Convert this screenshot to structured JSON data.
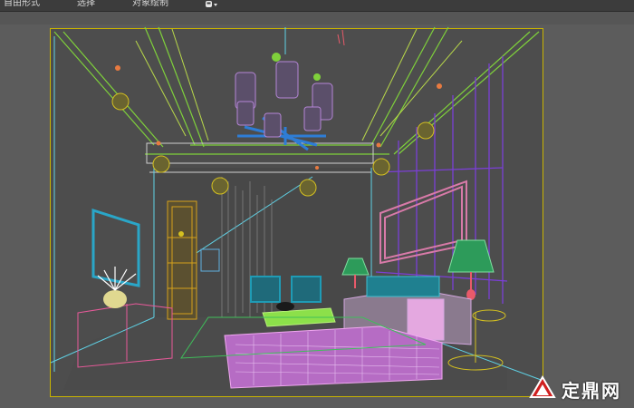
{
  "menu": {
    "item1": "自由形式",
    "item2": "选择",
    "item3": "对象绘制"
  },
  "watermark": {
    "text": "定鼎网",
    "logo_icon": "dingding-logo-icon",
    "color": "#ffffff"
  },
  "colors": {
    "viewport_border": "#c9b400",
    "toolbar_bg": "#3c3c3c",
    "viewport_bg": "#4d4d4d"
  }
}
